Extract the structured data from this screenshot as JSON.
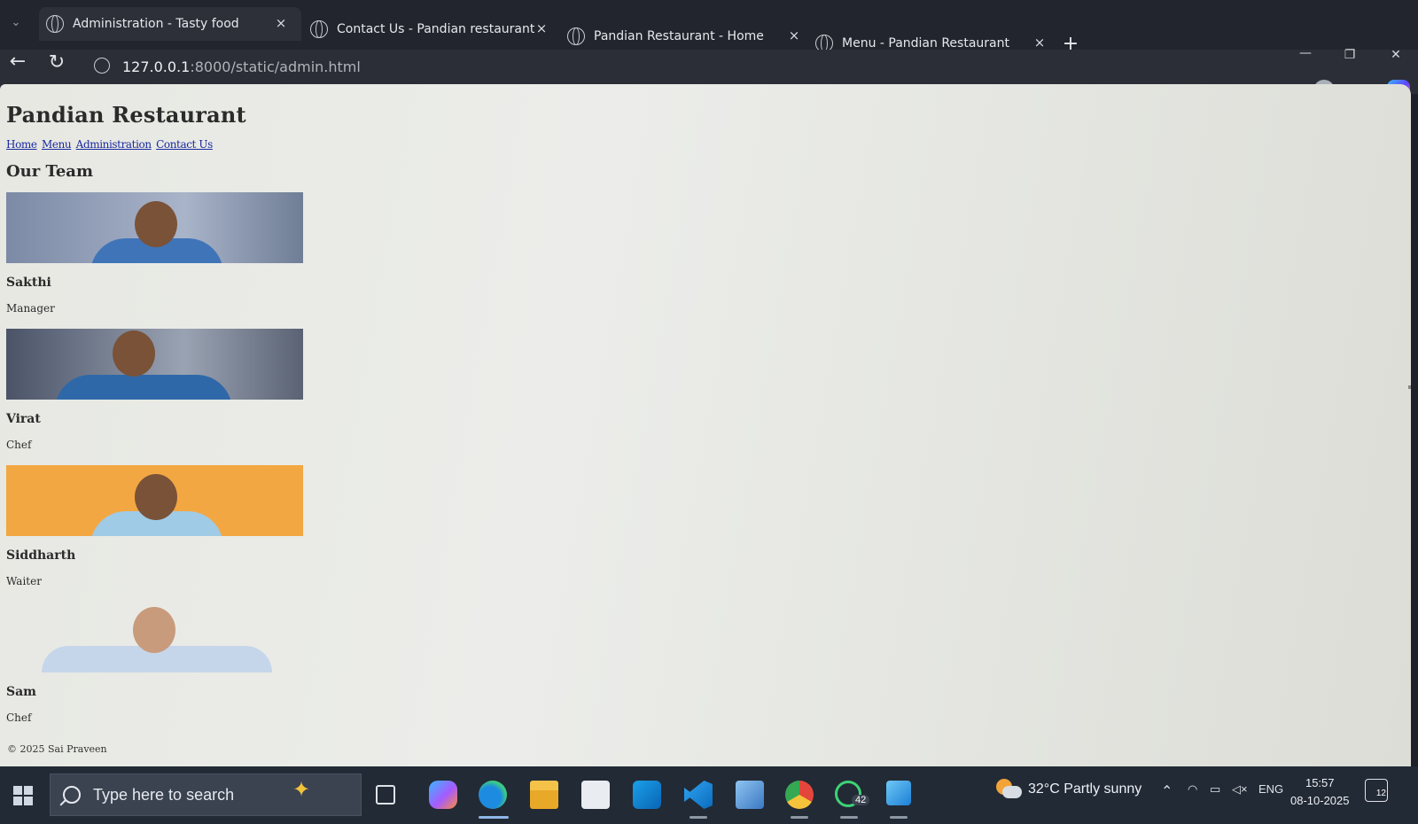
{
  "browser": {
    "tabs": [
      {
        "title": "Administration - Tasty food",
        "active": true
      },
      {
        "title": "Contact Us - Pandian restaurant",
        "active": false
      },
      {
        "title": "Pandian Restaurant - Home",
        "active": false
      },
      {
        "title": "Menu - Pandian Restaurant",
        "active": false
      }
    ],
    "close_glyph": "×",
    "new_tab_glyph": "+",
    "url_host": "127.0.0.1",
    "url_path": ":8000/static/admin.html",
    "icons": [
      "tab-list-icon",
      "globe-icon",
      "back-arrow-icon",
      "refresh-icon",
      "site-info-icon",
      "favorites-icon",
      "profile-icon",
      "more-icon",
      "copilot-icon",
      "minimize-icon",
      "restore-icon",
      "close-icon"
    ]
  },
  "site": {
    "title": "Pandian Restaurant",
    "nav": [
      "Home",
      "Menu",
      "Administration",
      "Contact Us"
    ],
    "section_title": "Our Team",
    "team": [
      {
        "name": "Sakthi",
        "role": "Manager"
      },
      {
        "name": "Virat",
        "role": "Chef"
      },
      {
        "name": "Siddharth",
        "role": "Waiter"
      },
      {
        "name": "Sam",
        "role": "Chef"
      }
    ],
    "footer": "© 2025 Sai Praveen",
    "link_color": "#1a2aa0"
  },
  "taskbar": {
    "search_placeholder": "Type here to search",
    "whatsapp_badge": "42",
    "weather": "32°C  Partly sunny",
    "language": "ENG",
    "time": "15:57",
    "date": "08-10-2025",
    "notifications": "12",
    "apps": [
      "windows-start-icon",
      "search-icon",
      "copilot-sparkle-icon",
      "task-view-icon",
      "copilot-app-icon",
      "edge-icon",
      "file-explorer-icon",
      "store-icon",
      "outlook-icon",
      "vscode-icon",
      "control-panel-icon",
      "chrome-icon",
      "whatsapp-icon",
      "photos-icon"
    ]
  }
}
